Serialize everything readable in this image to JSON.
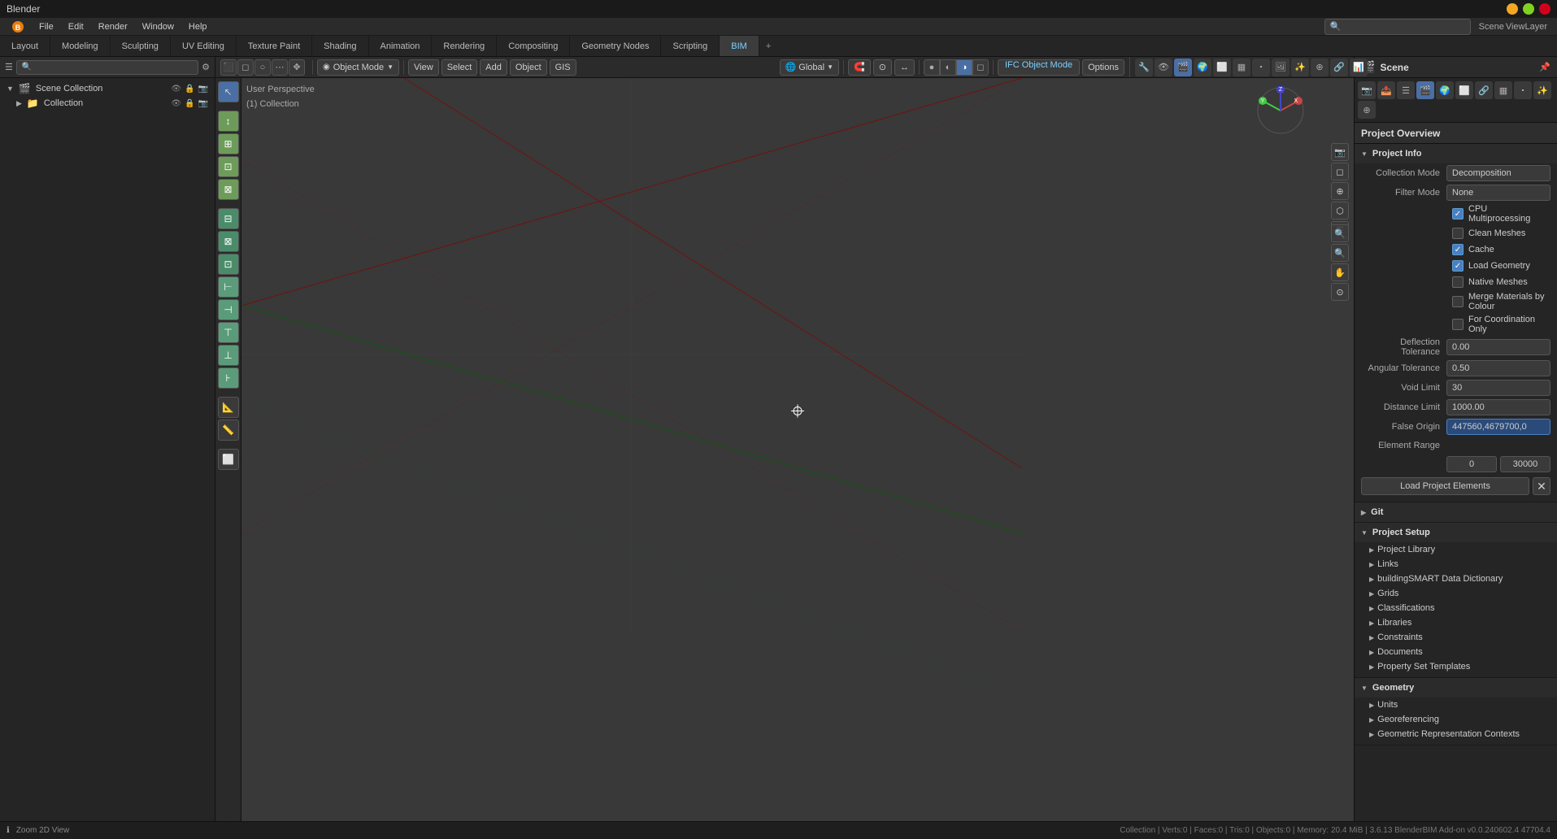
{
  "app": {
    "title": "Blender",
    "window_buttons": [
      "min",
      "max",
      "close"
    ]
  },
  "menubar": {
    "items": [
      "Blender",
      "File",
      "Edit",
      "Render",
      "Window",
      "Help"
    ]
  },
  "workspaces": {
    "tabs": [
      {
        "label": "Layout",
        "active": false
      },
      {
        "label": "Modeling",
        "active": false
      },
      {
        "label": "Sculpting",
        "active": false
      },
      {
        "label": "UV Editing",
        "active": false
      },
      {
        "label": "Texture Paint",
        "active": false
      },
      {
        "label": "Shading",
        "active": false
      },
      {
        "label": "Animation",
        "active": false
      },
      {
        "label": "Rendering",
        "active": false
      },
      {
        "label": "Compositing",
        "active": false
      },
      {
        "label": "Geometry Nodes",
        "active": false
      },
      {
        "label": "Scripting",
        "active": false
      },
      {
        "label": "BIM",
        "active": true
      }
    ],
    "plus_label": "+"
  },
  "outliner": {
    "scene_collection": "Scene Collection",
    "collection": "Collection"
  },
  "viewport": {
    "overlay_text_line1": "User Perspective",
    "overlay_text_line2": "(1) Collection",
    "mode": "Object Mode",
    "global_label": "Global",
    "ifc_mode": "IFC Object Mode",
    "options_label": "Options"
  },
  "toolbar": {
    "view": "View",
    "select": "Select",
    "add": "Add",
    "object": "Object",
    "gis": "GIS"
  },
  "right_panel": {
    "scene_label": "Scene",
    "project_overview_label": "Project Overview",
    "sections": {
      "project_info": {
        "label": "Project Info",
        "expanded": true,
        "collection_mode_label": "Collection Mode",
        "collection_mode_value": "Decomposition",
        "filter_mode_label": "Filter Mode",
        "filter_mode_value": "None",
        "checkboxes": [
          {
            "label": "CPU Multiprocessing",
            "checked": true
          },
          {
            "label": "Clean Meshes",
            "checked": false
          },
          {
            "label": "Cache",
            "checked": true
          },
          {
            "label": "Load Geometry",
            "checked": true
          },
          {
            "label": "Native Meshes",
            "checked": false
          },
          {
            "label": "Merge Materials by Colour",
            "checked": false
          },
          {
            "label": "For Coordination Only",
            "checked": false
          }
        ],
        "deflection_tolerance_label": "Deflection Tolerance",
        "deflection_tolerance_value": "0.00",
        "angular_tolerance_label": "Angular Tolerance",
        "angular_tolerance_value": "0.50",
        "void_limit_label": "Void Limit",
        "void_limit_value": "30",
        "distance_limit_label": "Distance Limit",
        "distance_limit_value": "1000.00",
        "false_origin_label": "False Origin",
        "false_origin_value": "447560,4679700,0",
        "element_range_label": "Element Range",
        "element_range_min": "0",
        "element_range_max": "30000",
        "load_btn_label": "Load Project Elements"
      },
      "git": {
        "label": "Git",
        "expanded": false
      },
      "project_setup": {
        "label": "Project Setup",
        "expanded": true,
        "items": [
          {
            "label": "Project Library",
            "expanded": false
          },
          {
            "label": "Links",
            "expanded": false
          },
          {
            "label": "buildingSMART Data Dictionary",
            "expanded": false
          },
          {
            "label": "Grids",
            "expanded": false
          },
          {
            "label": "Classifications",
            "expanded": false
          },
          {
            "label": "Libraries",
            "expanded": false
          },
          {
            "label": "Constraints",
            "expanded": false
          },
          {
            "label": "Documents",
            "expanded": false
          },
          {
            "label": "Property Set Templates",
            "expanded": false
          }
        ]
      },
      "geometry": {
        "label": "Geometry",
        "expanded": true,
        "items": [
          {
            "label": "Units",
            "expanded": false
          },
          {
            "label": "Georeferencing",
            "expanded": false
          },
          {
            "label": "Geometric Representation Contexts",
            "expanded": false
          }
        ]
      }
    }
  },
  "statusbar": {
    "text": "Collection | Verts:0 | Faces:0 | Tris:0 | Objects:0 | Memory: 20.4 MiB | 3.6.13  BlenderBIM Add-on v0.0.240602.4 47704.4"
  },
  "icons": {
    "arrow_right": "▶",
    "arrow_down": "▼",
    "check": "✓",
    "plus": "+",
    "x": "✕",
    "dot": "●",
    "scene": "🎬",
    "collection": "📁"
  }
}
